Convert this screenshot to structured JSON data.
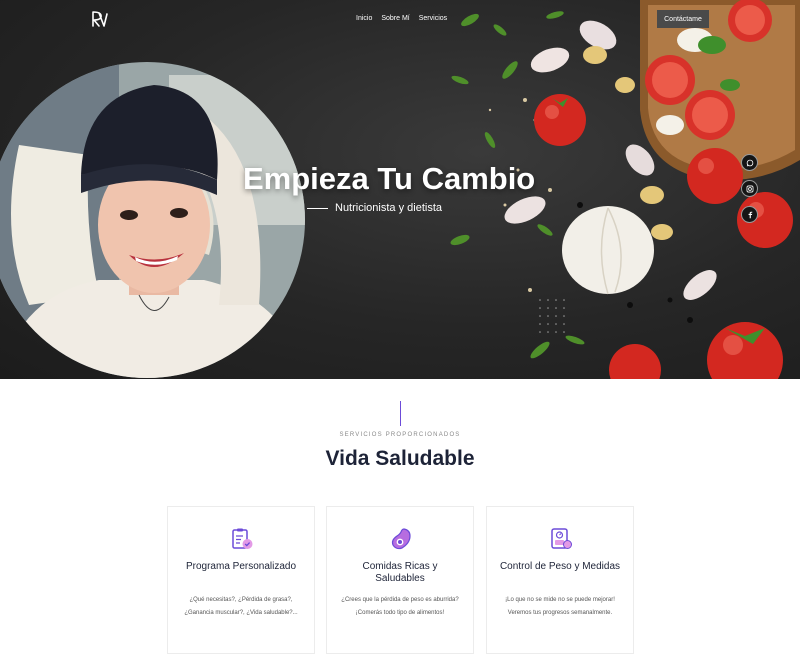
{
  "header": {
    "logo_text": "RV",
    "nav": [
      "Inicio",
      "Sobre Mí",
      "Servicios"
    ],
    "contact_label": "Contáctame"
  },
  "hero": {
    "title": "Empieza Tu Cambio",
    "subtitle": "Nutricionista y dietista",
    "social_icons": [
      "whatsapp-icon",
      "instagram-icon",
      "facebook-icon"
    ]
  },
  "services": {
    "eyebrow": "SERVICIOS PROPORCIONADOS",
    "title": "Vida Saludable",
    "accent_color": "#6c4bd8",
    "cards": [
      {
        "icon": "checklist-icon",
        "title": "Programa Personalizado",
        "text": "¿Qué necesitas?, ¿Pérdida de grasa?, ¿Ganancia muscular?, ¿Vida saludable?..."
      },
      {
        "icon": "avocado-icon",
        "title": "Comidas Ricas y Saludables",
        "text": "¿Crees que la pérdida de peso es aburrida? ¡Comerás todo tipo de alimentos!"
      },
      {
        "icon": "scale-icon",
        "title": "Control de Peso y Medidas",
        "text": "¡Lo que no se mide no se puede mejorar! Veremos tus progresos semanalmente."
      }
    ]
  }
}
